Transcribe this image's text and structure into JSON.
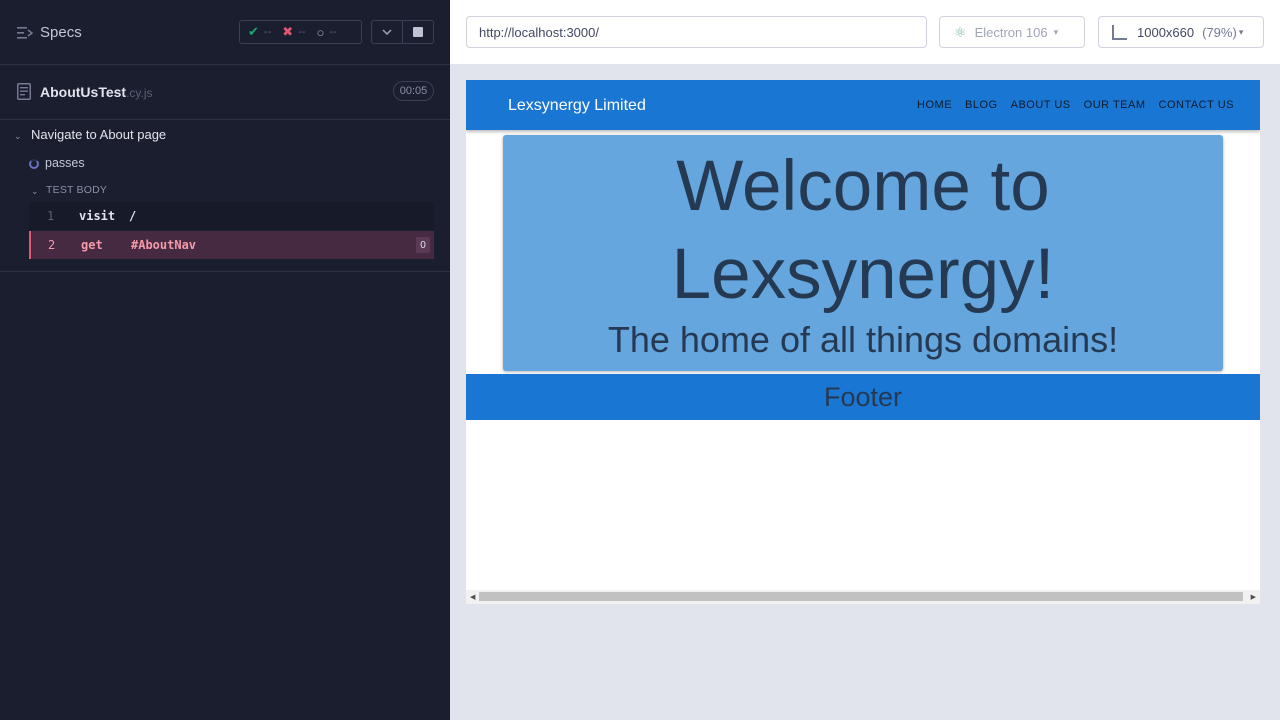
{
  "reporter": {
    "header": {
      "specs_label": "Specs",
      "stats": {
        "passed": "--",
        "failed": "--",
        "pending": "--"
      }
    },
    "spec": {
      "name": "AboutUsTest",
      "ext": ".cy.js",
      "duration": "00:05"
    },
    "suite": {
      "title": "Navigate to About page",
      "test_title": "passes",
      "body_label": "TEST BODY",
      "commands": [
        {
          "num": "1",
          "name": "visit",
          "message": "/"
        },
        {
          "num": "2",
          "name": "get",
          "message": "#AboutNav",
          "badge": "0"
        }
      ]
    }
  },
  "aut": {
    "url": "http://localhost:3000/",
    "browser": "Electron 106",
    "viewport": {
      "size": "1000x660",
      "scale": "(79%)"
    },
    "site": {
      "brand": "Lexsynergy Limited",
      "nav": [
        "HOME",
        "BLOG",
        "ABOUT US",
        "OUR TEAM",
        "CONTACT US"
      ],
      "hero_line1": "Welcome to",
      "hero_line2": "Lexsynergy!",
      "hero_sub": "The home of all things domains!",
      "footer": "Footer"
    }
  },
  "colors": {
    "reporter_bg": "#1b1e2e",
    "site_primary": "#1976d2",
    "hero_bg": "#64a6dd",
    "failed_command": "#e45770"
  }
}
